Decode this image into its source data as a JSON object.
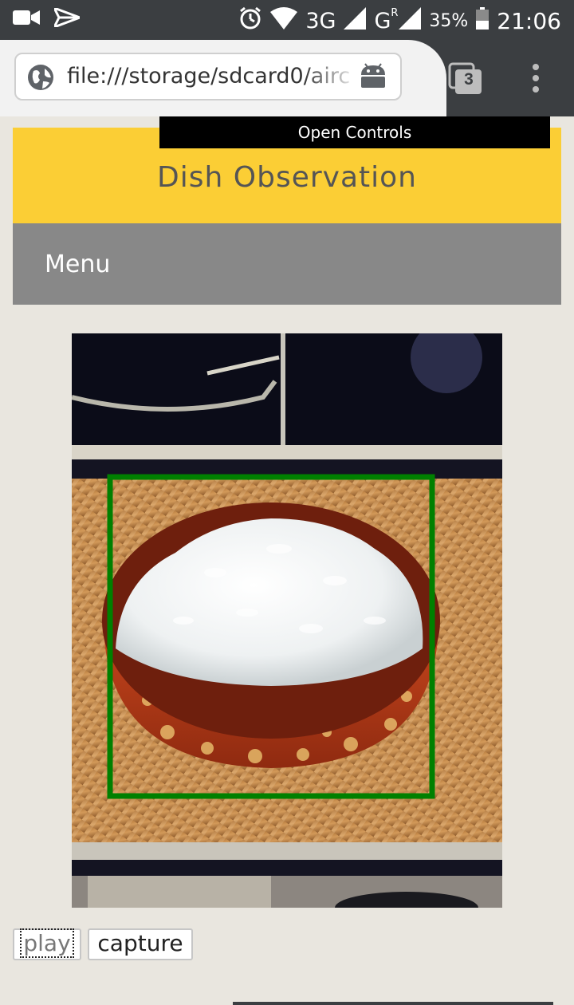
{
  "status_bar": {
    "network_3g": "3G",
    "network_g": "G",
    "network_r": "R",
    "battery": "35%",
    "time": "21:06",
    "icons": [
      "video-camera-icon",
      "send-icon",
      "alarm-icon",
      "wifi-icon",
      "signal-icon",
      "battery-icon"
    ]
  },
  "browser": {
    "url": "file:///storage/sdcard0/airc",
    "tab_count": "3",
    "icons": [
      "globe-icon",
      "android-icon",
      "tabs-icon",
      "overflow-menu-icon"
    ]
  },
  "page": {
    "tooltip": "Open Controls",
    "title": "Dish Observation",
    "menu_label": "Menu",
    "detection_color": "#008000",
    "buttons": {
      "play": "play",
      "capture": "capture"
    }
  },
  "colors": {
    "header": "#fbce35",
    "menu": "#888888",
    "status_bar": "#3b3e41",
    "page_bg": "#e9e6df"
  }
}
